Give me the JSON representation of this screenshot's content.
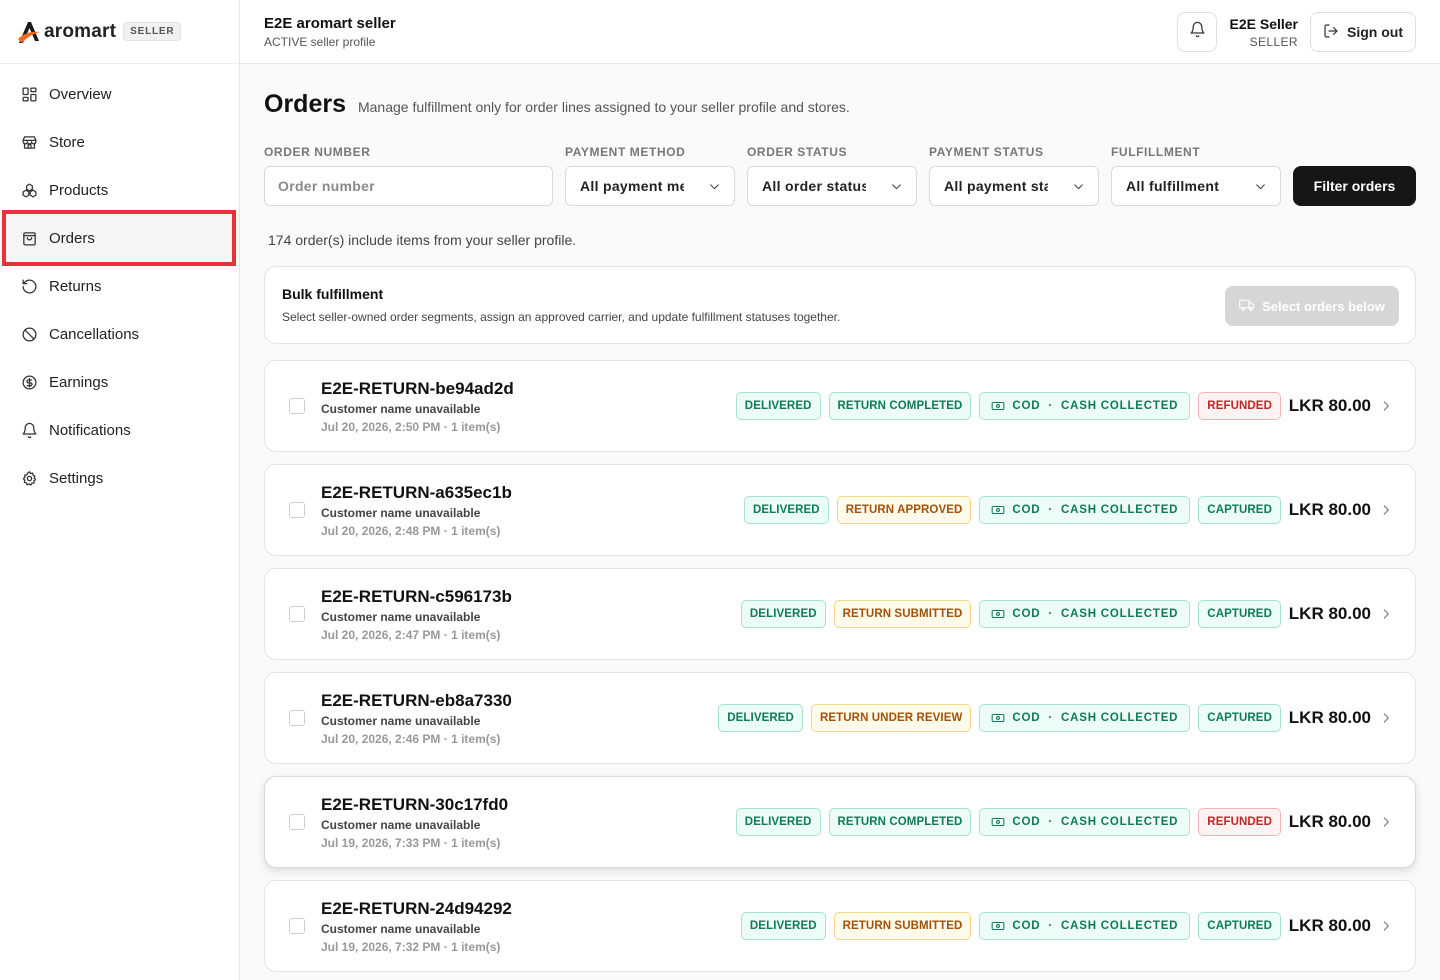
{
  "brand": {
    "name": "aromart",
    "badge": "SELLER"
  },
  "sidebar": {
    "items": [
      {
        "label": "Overview",
        "icon": "grid-icon"
      },
      {
        "label": "Store",
        "icon": "store-icon"
      },
      {
        "label": "Products",
        "icon": "products-icon"
      },
      {
        "label": "Orders",
        "icon": "shopping-bag-icon",
        "active": true
      },
      {
        "label": "Returns",
        "icon": "rotate-ccw-icon"
      },
      {
        "label": "Cancellations",
        "icon": "ban-icon"
      },
      {
        "label": "Earnings",
        "icon": "dollar-circle-icon"
      },
      {
        "label": "Notifications",
        "icon": "bell-icon"
      },
      {
        "label": "Settings",
        "icon": "gear-icon"
      }
    ]
  },
  "topbar": {
    "title": "E2E aromart seller",
    "subtitle": "ACTIVE seller profile",
    "user_name": "E2E Seller",
    "user_role": "SELLER",
    "signout_label": "Sign out"
  },
  "page": {
    "title": "Orders",
    "description": "Manage fulfillment only for order lines assigned to your seller profile and stores."
  },
  "filters": {
    "order_number_label": "ORDER NUMBER",
    "order_number_placeholder": "Order number",
    "payment_method_label": "PAYMENT METHOD",
    "payment_method_value": "All payment methods",
    "order_status_label": "ORDER STATUS",
    "order_status_value": "All order statuses",
    "payment_status_label": "PAYMENT STATUS",
    "payment_status_value": "All payment statuses",
    "fulfillment_label": "FULFILLMENT",
    "fulfillment_value": "All fulfillment",
    "filter_button": "Filter orders"
  },
  "summary": {
    "count_text": "174 order(s) include items from your seller profile."
  },
  "bulk": {
    "title": "Bulk fulfillment",
    "description": "Select seller-owned order segments, assign an approved carrier, and update fulfillment statuses together.",
    "button": "Select orders below"
  },
  "orders": [
    {
      "number": "E2E-RETURN-be94ad2d",
      "customer": "Customer name unavailable",
      "meta": "Jul 20, 2026, 2:50 PM · 1 item(s)",
      "status": "DELIVERED",
      "return_status": "RETURN COMPLETED",
      "return_color": "green",
      "cod": "COD",
      "cod_status": "CASH COLLECTED",
      "payment": "REFUNDED",
      "payment_color": "red",
      "amount": "LKR 80.00"
    },
    {
      "number": "E2E-RETURN-a635ec1b",
      "customer": "Customer name unavailable",
      "meta": "Jul 20, 2026, 2:48 PM · 1 item(s)",
      "status": "DELIVERED",
      "return_status": "RETURN APPROVED",
      "return_color": "amber",
      "cod": "COD",
      "cod_status": "CASH COLLECTED",
      "payment": "CAPTURED",
      "payment_color": "green",
      "amount": "LKR 80.00"
    },
    {
      "number": "E2E-RETURN-c596173b",
      "customer": "Customer name unavailable",
      "meta": "Jul 20, 2026, 2:47 PM · 1 item(s)",
      "status": "DELIVERED",
      "return_status": "RETURN SUBMITTED",
      "return_color": "amber",
      "cod": "COD",
      "cod_status": "CASH COLLECTED",
      "payment": "CAPTURED",
      "payment_color": "green",
      "amount": "LKR 80.00"
    },
    {
      "number": "E2E-RETURN-eb8a7330",
      "customer": "Customer name unavailable",
      "meta": "Jul 20, 2026, 2:46 PM · 1 item(s)",
      "status": "DELIVERED",
      "return_status": "RETURN UNDER REVIEW",
      "return_color": "amber",
      "cod": "COD",
      "cod_status": "CASH COLLECTED",
      "payment": "CAPTURED",
      "payment_color": "green",
      "amount": "LKR 80.00"
    },
    {
      "number": "E2E-RETURN-30c17fd0",
      "customer": "Customer name unavailable",
      "meta": "Jul 19, 2026, 7:33 PM · 1 item(s)",
      "status": "DELIVERED",
      "return_status": "RETURN COMPLETED",
      "return_color": "green",
      "cod": "COD",
      "cod_status": "CASH COLLECTED",
      "payment": "REFUNDED",
      "payment_color": "red",
      "amount": "LKR 80.00"
    },
    {
      "number": "E2E-RETURN-24d94292",
      "customer": "Customer name unavailable",
      "meta": "Jul 19, 2026, 7:32 PM · 1 item(s)",
      "status": "DELIVERED",
      "return_status": "RETURN SUBMITTED",
      "return_color": "amber",
      "cod": "COD",
      "cod_status": "CASH COLLECTED",
      "payment": "CAPTURED",
      "payment_color": "green",
      "amount": "LKR 80.00"
    }
  ]
}
